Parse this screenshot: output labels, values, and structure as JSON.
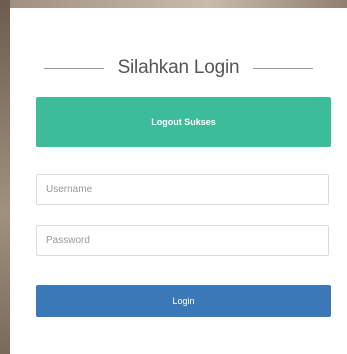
{
  "login_panel": {
    "title": "Silahkan Login",
    "alert_message": "Logout Sukses",
    "username_placeholder": "Username",
    "password_placeholder": "Password",
    "login_button_label": "Login"
  },
  "colors": {
    "alert_background": "#3dbc9a",
    "button_background": "#3a78b7",
    "card_background": "#ffffff"
  }
}
